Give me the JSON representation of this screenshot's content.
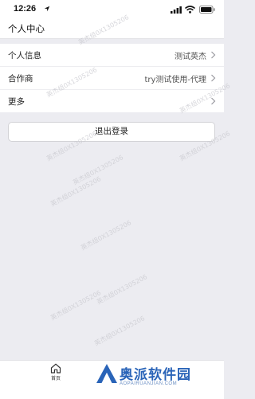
{
  "status_bar": {
    "time": "12:26"
  },
  "nav": {
    "title": "个人中心"
  },
  "menu": {
    "items": [
      {
        "label": "个人信息",
        "value": "测试英杰"
      },
      {
        "label": "合作商",
        "value": "try测试使用-代理"
      },
      {
        "label": "更多",
        "value": ""
      }
    ]
  },
  "logout": {
    "label": "退出登录"
  },
  "watermark": {
    "text": "英杰组0X1305206"
  },
  "tab_bar": {
    "home_label": "首页"
  },
  "brand": {
    "name": "奥派软件园",
    "url": "AOPAIRUANJIAN.COM",
    "color": "#2a64b8"
  },
  "icons": [
    "location-arrow-icon",
    "signal-icon",
    "wifi-icon",
    "battery-icon",
    "chevron-right-icon",
    "home-icon"
  ]
}
